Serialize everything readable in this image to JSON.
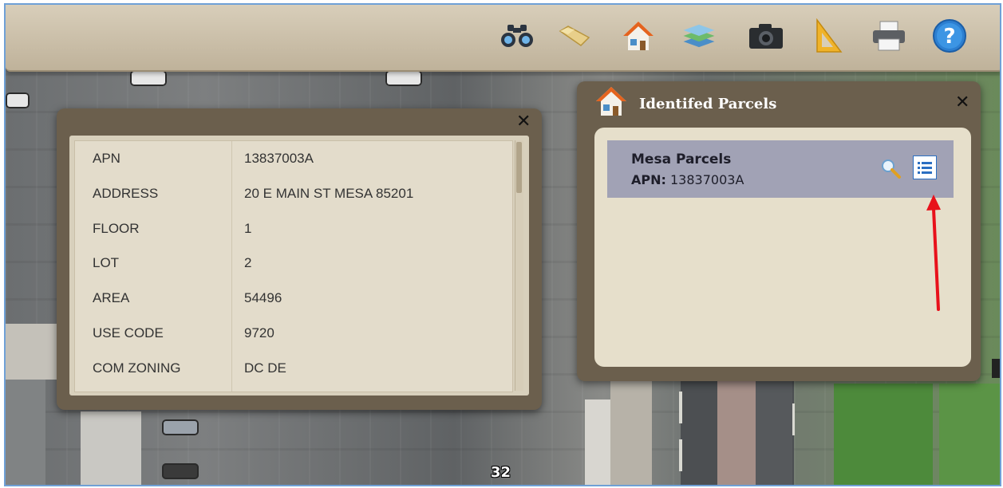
{
  "toolbar": {
    "tools": [
      {
        "icon": "binoculars-icon",
        "label": ""
      },
      {
        "icon": "folder-icon",
        "label": ""
      },
      {
        "icon": "home-icon",
        "label": ""
      },
      {
        "icon": "layers-icon",
        "label": ""
      },
      {
        "icon": "camera-icon",
        "label": ""
      },
      {
        "icon": "ruler-triangle-icon",
        "label": ""
      },
      {
        "icon": "printer-icon",
        "label": ""
      },
      {
        "icon": "help-icon",
        "label": "?"
      }
    ]
  },
  "attributes_popup": {
    "close": "✕",
    "rows": [
      {
        "key": "APN",
        "value": "13837003A"
      },
      {
        "key": "ADDRESS",
        "value": "20 E MAIN ST MESA 85201"
      },
      {
        "key": "FLOOR",
        "value": "1"
      },
      {
        "key": "LOT",
        "value": "2"
      },
      {
        "key": "AREA",
        "value": "54496"
      },
      {
        "key": "USE CODE",
        "value": "9720"
      },
      {
        "key": "COM ZONING",
        "value": "DC DE"
      }
    ]
  },
  "identified_parcels": {
    "title": "Identifed Parcels",
    "close": "✕",
    "results": [
      {
        "layer": "Mesa Parcels",
        "apn_label": "APN:",
        "apn_value": "13837003A"
      }
    ]
  },
  "map_labels": [
    "32"
  ],
  "annotation_color": "#e8111b"
}
